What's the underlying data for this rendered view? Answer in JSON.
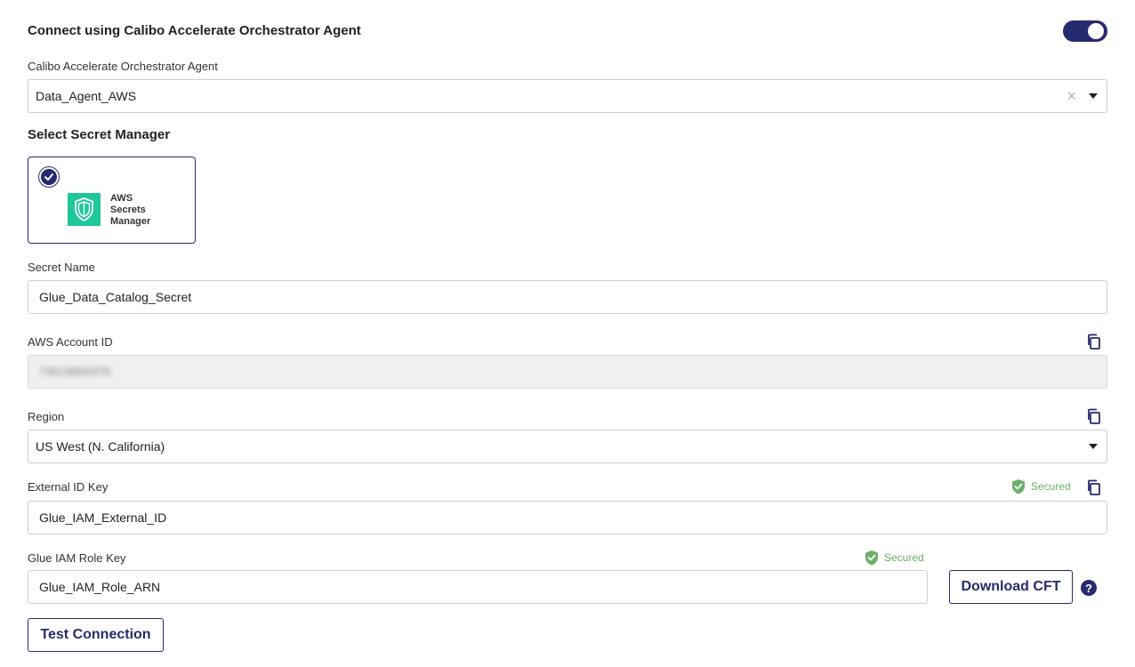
{
  "agent_section": {
    "title": "Connect using Calibo Accelerate Orchestrator Agent",
    "toggle_on": true,
    "agent_label": "Calibo Accelerate Orchestrator Agent",
    "agent_value": "Data_Agent_AWS"
  },
  "secret_manager": {
    "title": "Select Secret Manager",
    "option": {
      "line1": "AWS",
      "line2": "Secrets",
      "line3": "Manager",
      "selected": true,
      "icon": "shield-icon",
      "tile_color": "#1ec79a"
    }
  },
  "fields": {
    "secret_name": {
      "label": "Secret Name",
      "value": "Glue_Data_Catalog_Secret"
    },
    "aws_account_id": {
      "label": "AWS Account ID",
      "value": "739128820376"
    },
    "region": {
      "label": "Region",
      "value": "US West (N. California)"
    },
    "external_id_key": {
      "label": "External ID Key",
      "value": "Glue_IAM_External_ID",
      "secured_label": "Secured"
    },
    "glue_iam_role_key": {
      "label": "Glue IAM Role Key",
      "value": "Glue_IAM_Role_ARN",
      "secured_label": "Secured"
    }
  },
  "buttons": {
    "download_cft": "Download CFT",
    "test_connection": "Test Connection",
    "help": "?"
  },
  "colors": {
    "accent": "#262a6e",
    "secured_green": "#6cae6a",
    "aws_green": "#1ec79a"
  }
}
